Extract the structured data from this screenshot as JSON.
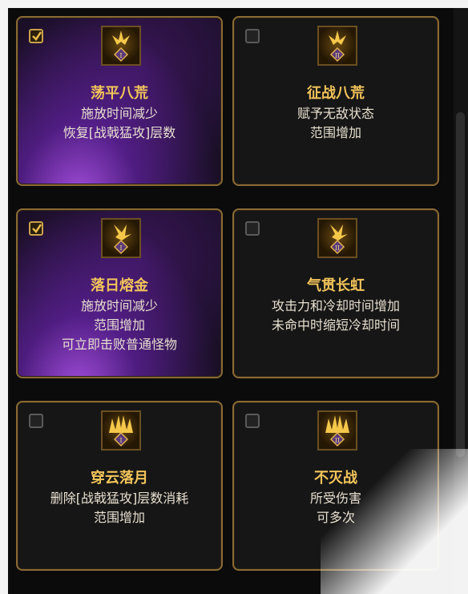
{
  "cards": [
    {
      "name": "荡平八荒",
      "tier": "I",
      "checked": true,
      "lines": [
        "施放时间减少",
        "恢复[战戟猛攻]层数"
      ]
    },
    {
      "name": "征战八荒",
      "tier": "II",
      "checked": false,
      "lines": [
        "赋予无敌状态",
        "范围增加"
      ]
    },
    {
      "name": "落日熔金",
      "tier": "I",
      "checked": true,
      "lines": [
        "施放时间减少",
        "范围增加",
        "可立即击败普通怪物"
      ]
    },
    {
      "name": "气贯长虹",
      "tier": "II",
      "checked": false,
      "lines": [
        "攻击力和冷却时间增加",
        "未命中时缩短冷却时间"
      ]
    },
    {
      "name": "穿云落月",
      "tier": "I",
      "checked": false,
      "lines": [
        "删除[战戟猛攻]层数消耗",
        "范围增加"
      ]
    },
    {
      "name": "不灭战",
      "tier": "II",
      "checked": false,
      "lines": [
        "所受伤害",
        "可多次"
      ]
    }
  ],
  "colors": {
    "gold": "#f2c45a",
    "border": "#8a6a35",
    "selected_purple": "#7a2cc8"
  }
}
